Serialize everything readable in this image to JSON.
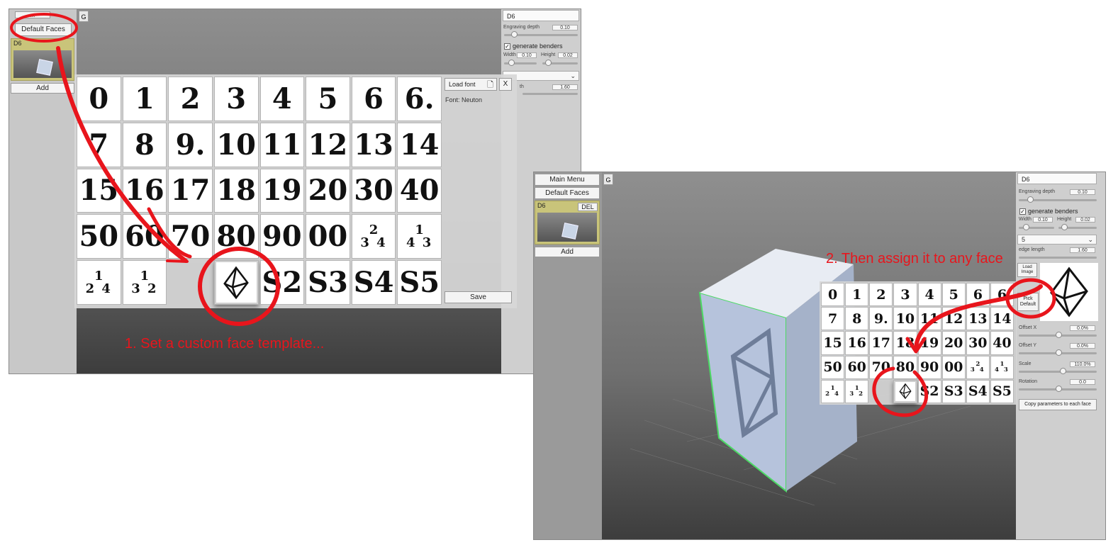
{
  "left_screenshot": {
    "gizmo_btn": "G",
    "default_faces_btn": "Default Faces",
    "top_dots": "...",
    "die_card_label": "D6",
    "add_btn": "Add",
    "right_panel": {
      "die_name": "D6",
      "engraving_label": "Engraving depth",
      "engraving_value": "0.10",
      "benders_label": "generate benders",
      "width_label": "Width",
      "width_value": "0.10",
      "height_label": "Height",
      "height_value": "0.02",
      "edge_suffix": "th",
      "edge_value": "1.60"
    },
    "picker": {
      "load_font_btn": "Load font",
      "close_btn": "X",
      "font_info": "Font: Neuton",
      "save_btn": "Save",
      "cells": [
        "0",
        "1",
        "2",
        "3",
        "4",
        "5",
        "6",
        "6.",
        "7",
        "8",
        "9.",
        "10",
        "11",
        "12",
        "13",
        "14",
        "15",
        "16",
        "17",
        "18",
        "19",
        "20",
        "30",
        "40",
        "50",
        "60",
        "70",
        "80",
        "90",
        "00"
      ],
      "small_cells": [
        {
          "top": "2",
          "bottom": "3 4"
        },
        {
          "top": "1",
          "bottom": "4 3"
        },
        {
          "top": "1",
          "bottom": "2 4"
        },
        {
          "top": "1",
          "bottom": "3 2"
        }
      ],
      "tail_cells": [
        "S2",
        "S3",
        "S4",
        "S5"
      ]
    }
  },
  "right_screenshot": {
    "main_menu_btn": "Main Menu",
    "gizmo_btn": "G",
    "default_faces_btn": "Default Faces",
    "die_card_label": "D6",
    "del_btn": "DEL",
    "add_btn": "Add",
    "right_panel": {
      "die_name": "D6",
      "engraving_label": "Engraving depth",
      "engraving_value": "0.10",
      "benders_label": "generate benders",
      "width_label": "Width",
      "width_value": "0.10",
      "height_label": "Height",
      "height_value": "0.02",
      "face_select": "5",
      "edge_label": "edge length",
      "edge_value": "1.60",
      "load_image_btn": "Load Image",
      "pick_default_btn": "Pick Default",
      "offset_x_label": "Offset X",
      "offset_x_value": "0.0%",
      "offset_y_label": "Offset Y",
      "offset_y_value": "0.0%",
      "scale_label": "Scale",
      "scale_value": "110.0%",
      "rotation_label": "Rotation",
      "rotation_value": "0.0",
      "copy_btn": "Copy parameters to each face"
    },
    "picker": {
      "cells": [
        "0",
        "1",
        "2",
        "3",
        "4",
        "5",
        "6",
        "6",
        "7",
        "8",
        "9.",
        "10",
        "11",
        "12",
        "13",
        "14",
        "15",
        "16",
        "17",
        "18",
        "19",
        "20",
        "30",
        "40",
        "50",
        "60",
        "70",
        "80",
        "90",
        "00"
      ],
      "small_cells": [
        {
          "top": "2",
          "bottom": "3 4"
        },
        {
          "top": "1",
          "bottom": "4 3"
        },
        {
          "top": "1",
          "bottom": "2 4"
        },
        {
          "top": "1",
          "bottom": "3 2"
        }
      ],
      "tail_cells": [
        "S2",
        "S3",
        "S4",
        "S5"
      ]
    }
  },
  "annotations": {
    "step1": "1. Set a custom face template...",
    "step2": "2. Then assign it to any face"
  },
  "colors": {
    "annotation_red": "#e8151c",
    "highlight_green": "#4cd964",
    "die_card": "#c9c47a"
  }
}
